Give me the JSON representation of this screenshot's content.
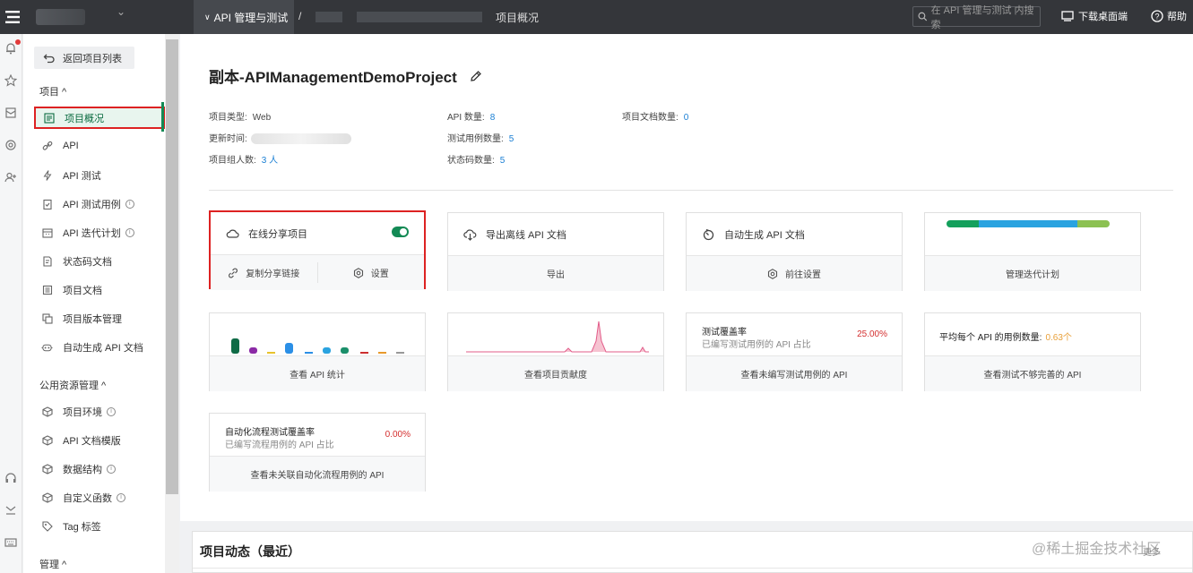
{
  "topbar": {
    "active_crumb": "API 管理与测试",
    "separator": "/",
    "current_page": "项目概况",
    "search_placeholder": "在 API 管理与测试 内搜索",
    "download_label": "下载桌面端",
    "help_label": "帮助"
  },
  "sidenav": {
    "back_label": "返回项目列表",
    "group_project": "项目 ^",
    "group_public": "公用资源管理 ^",
    "group_manage": "管理 ^",
    "project_items": [
      {
        "label": "项目概况",
        "icon": "overview-icon"
      },
      {
        "label": "API",
        "icon": "link-icon"
      },
      {
        "label": "API 测试",
        "icon": "bolt-icon"
      },
      {
        "label": "API 测试用例",
        "icon": "clipboard-check-icon"
      },
      {
        "label": "API 迭代计划",
        "icon": "calendar-icon"
      },
      {
        "label": "状态码文档",
        "icon": "doc-icon"
      },
      {
        "label": "项目文档",
        "icon": "list-doc-icon"
      },
      {
        "label": "项目版本管理",
        "icon": "copy-icon"
      },
      {
        "label": "自动生成 API 文档",
        "icon": "robot-icon"
      }
    ],
    "public_items": [
      {
        "label": "项目环境",
        "icon": "cube-icon"
      },
      {
        "label": "API 文档模版",
        "icon": "cube-icon"
      },
      {
        "label": "数据结构",
        "icon": "cube-icon"
      },
      {
        "label": "自定义函数",
        "icon": "cube-icon"
      },
      {
        "label": "Tag 标签",
        "icon": "tag-icon"
      }
    ]
  },
  "project": {
    "title": "副本-APIManagementDemoProject",
    "type_label": "项目类型:",
    "type_value": "Web",
    "updated_label": "更新时间:",
    "members_label": "项目组人数:",
    "members_value": "3 人",
    "api_count_label": "API 数量:",
    "api_count_value": "8",
    "test_case_label": "测试用例数量:",
    "test_case_value": "5",
    "status_code_label": "状态码数量:",
    "status_code_value": "5",
    "doc_count_label": "项目文档数量:",
    "doc_count_value": "0"
  },
  "cards": {
    "share": {
      "title": "在线分享项目",
      "enabled": true,
      "copy_label": "复制分享链接",
      "settings_label": "设置"
    },
    "export": {
      "title": "导出离线 API 文档",
      "action": "导出"
    },
    "autogen": {
      "title": "自动生成 API 文档",
      "action": "前往设置"
    },
    "iteration": {
      "action": "管理迭代计划"
    },
    "api_stats": {
      "action": "查看 API 统计"
    },
    "contribution": {
      "action": "查看项目贡献度"
    },
    "test_coverage": {
      "title": "测试覆盖率",
      "subtitle": "已编写测试用例的 API 占比",
      "value": "25.00%",
      "action": "查看未编写测试用例的 API"
    },
    "avg_cases": {
      "label": "平均每个 API 的用例数量:",
      "value": "0.63个",
      "action": "查看测试不够完善的 API"
    },
    "auto_coverage": {
      "title": "自动化流程测试覆盖率",
      "subtitle": "已编写流程用例的 API 占比",
      "value": "0.00%",
      "action": "查看未关联自动化流程用例的 API"
    }
  },
  "feed": {
    "title": "项目动态（最近）",
    "more_label": "更多"
  },
  "watermark": "@稀土掘金技术社区",
  "colors": {
    "brand": "#138a55",
    "accent_blue": "#1a7fd4",
    "danger": "#d42f2f",
    "warn": "#e8a03a"
  }
}
